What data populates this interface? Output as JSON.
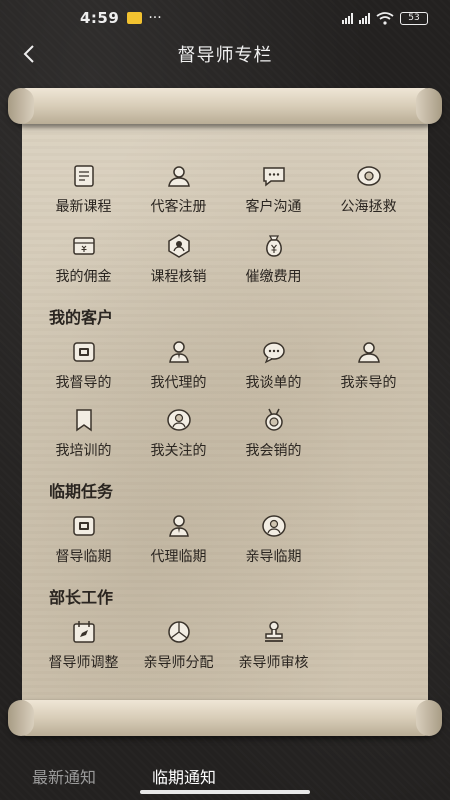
{
  "status_bar": {
    "time": "4:59",
    "dots": "···",
    "battery": "53"
  },
  "header": {
    "title": "督导师专栏"
  },
  "menu": {
    "row1": [
      "最新课程",
      "代客注册",
      "客户沟通",
      "公海拯救"
    ],
    "row2": [
      "我的佣金",
      "课程核销",
      "催缴费用"
    ]
  },
  "my_customers": {
    "title": "我的客户",
    "row1": [
      "我督导的",
      "我代理的",
      "我谈单的",
      "我亲导的"
    ],
    "row2": [
      "我培训的",
      "我关注的",
      "我会销的"
    ]
  },
  "expiring_tasks": {
    "title": "临期任务",
    "row1": [
      "督导临期",
      "代理临期",
      "亲导临期"
    ]
  },
  "minister_work": {
    "title": "部长工作",
    "row1": [
      "督导师调整",
      "亲导师分配",
      "亲导师审核"
    ]
  },
  "tabs": {
    "latest": "最新通知",
    "expiring": "临期通知"
  }
}
